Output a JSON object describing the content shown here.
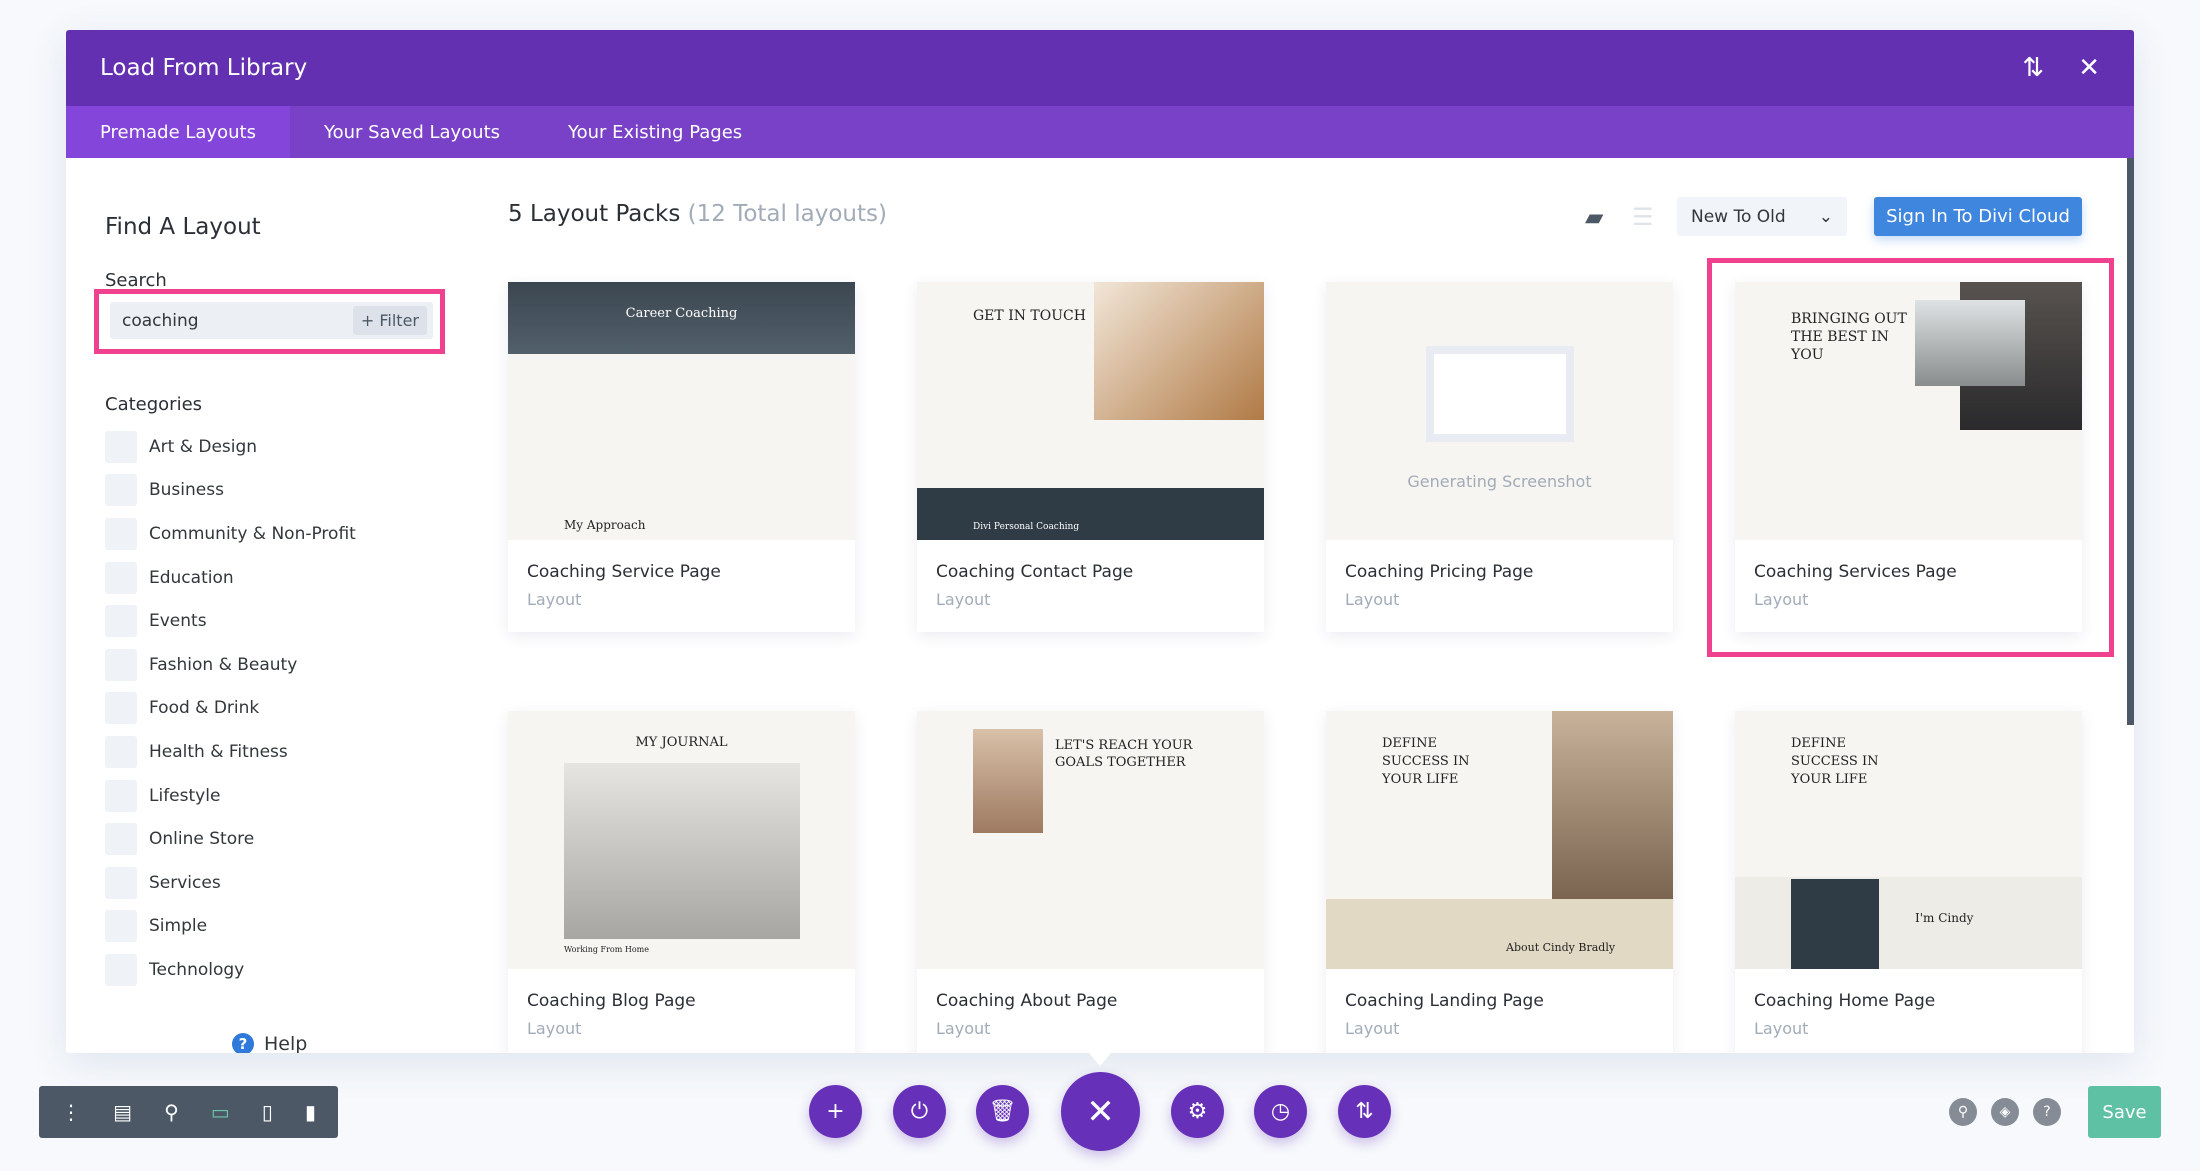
{
  "modal": {
    "title": "Load From Library",
    "icons": [
      "sort-icon",
      "close-icon"
    ]
  },
  "tabs": [
    {
      "label": "Premade Layouts",
      "active": true
    },
    {
      "label": "Your Saved Layouts"
    },
    {
      "label": "Your Existing Pages"
    }
  ],
  "sidebar": {
    "heading": "Find A Layout",
    "search_label": "Search",
    "search_value": "coaching",
    "filter_label": "+ Filter",
    "categories_label": "Categories",
    "categories": [
      "Art & Design",
      "Business",
      "Community & Non-Profit",
      "Education",
      "Events",
      "Fashion & Beauty",
      "Food & Drink",
      "Health & Fitness",
      "Lifestyle",
      "Online Store",
      "Services",
      "Simple",
      "Technology"
    ],
    "help_label": "Help"
  },
  "main": {
    "count_label": "5 Layout Packs",
    "total_label": "(12 Total layouts)",
    "sort_value": "New To Old",
    "signin_label": "Sign In To Divi Cloud",
    "cards": [
      {
        "title": "Coaching Service Page",
        "type": "Layout",
        "thumb_text": "Career Coaching",
        "thumb_sub": "My Approach"
      },
      {
        "title": "Coaching Contact Page",
        "type": "Layout",
        "thumb_text": "GET IN TOUCH",
        "thumb_sub": "Divi Personal Coaching"
      },
      {
        "title": "Coaching Pricing Page",
        "type": "Layout",
        "thumb_text": "Generating Screenshot"
      },
      {
        "title": "Coaching Services Page",
        "type": "Layout",
        "thumb_text": "BRINGING OUT THE BEST IN YOU",
        "highlighted": true
      },
      {
        "title": "Coaching Blog Page",
        "type": "Layout",
        "thumb_text": "MY JOURNAL",
        "thumb_sub": "Working From Home"
      },
      {
        "title": "Coaching About Page",
        "type": "Layout",
        "thumb_text": "LET'S REACH YOUR GOALS TOGETHER"
      },
      {
        "title": "Coaching Landing Page",
        "type": "Layout",
        "thumb_text": "DEFINE SUCCESS IN YOUR LIFE",
        "thumb_sub": "About Cindy Bradly"
      },
      {
        "title": "Coaching Home Page",
        "type": "Layout",
        "thumb_text": "DEFINE SUCCESS IN YOUR LIFE",
        "thumb_sub": "I'm Cindy"
      }
    ]
  },
  "footer": {
    "save_label": "Save"
  },
  "colors": {
    "header": "#6230b0",
    "tabs": "#7941c7",
    "accent_blue": "#3f86de",
    "highlight": "#f0418f",
    "save": "#5fc1a3"
  }
}
